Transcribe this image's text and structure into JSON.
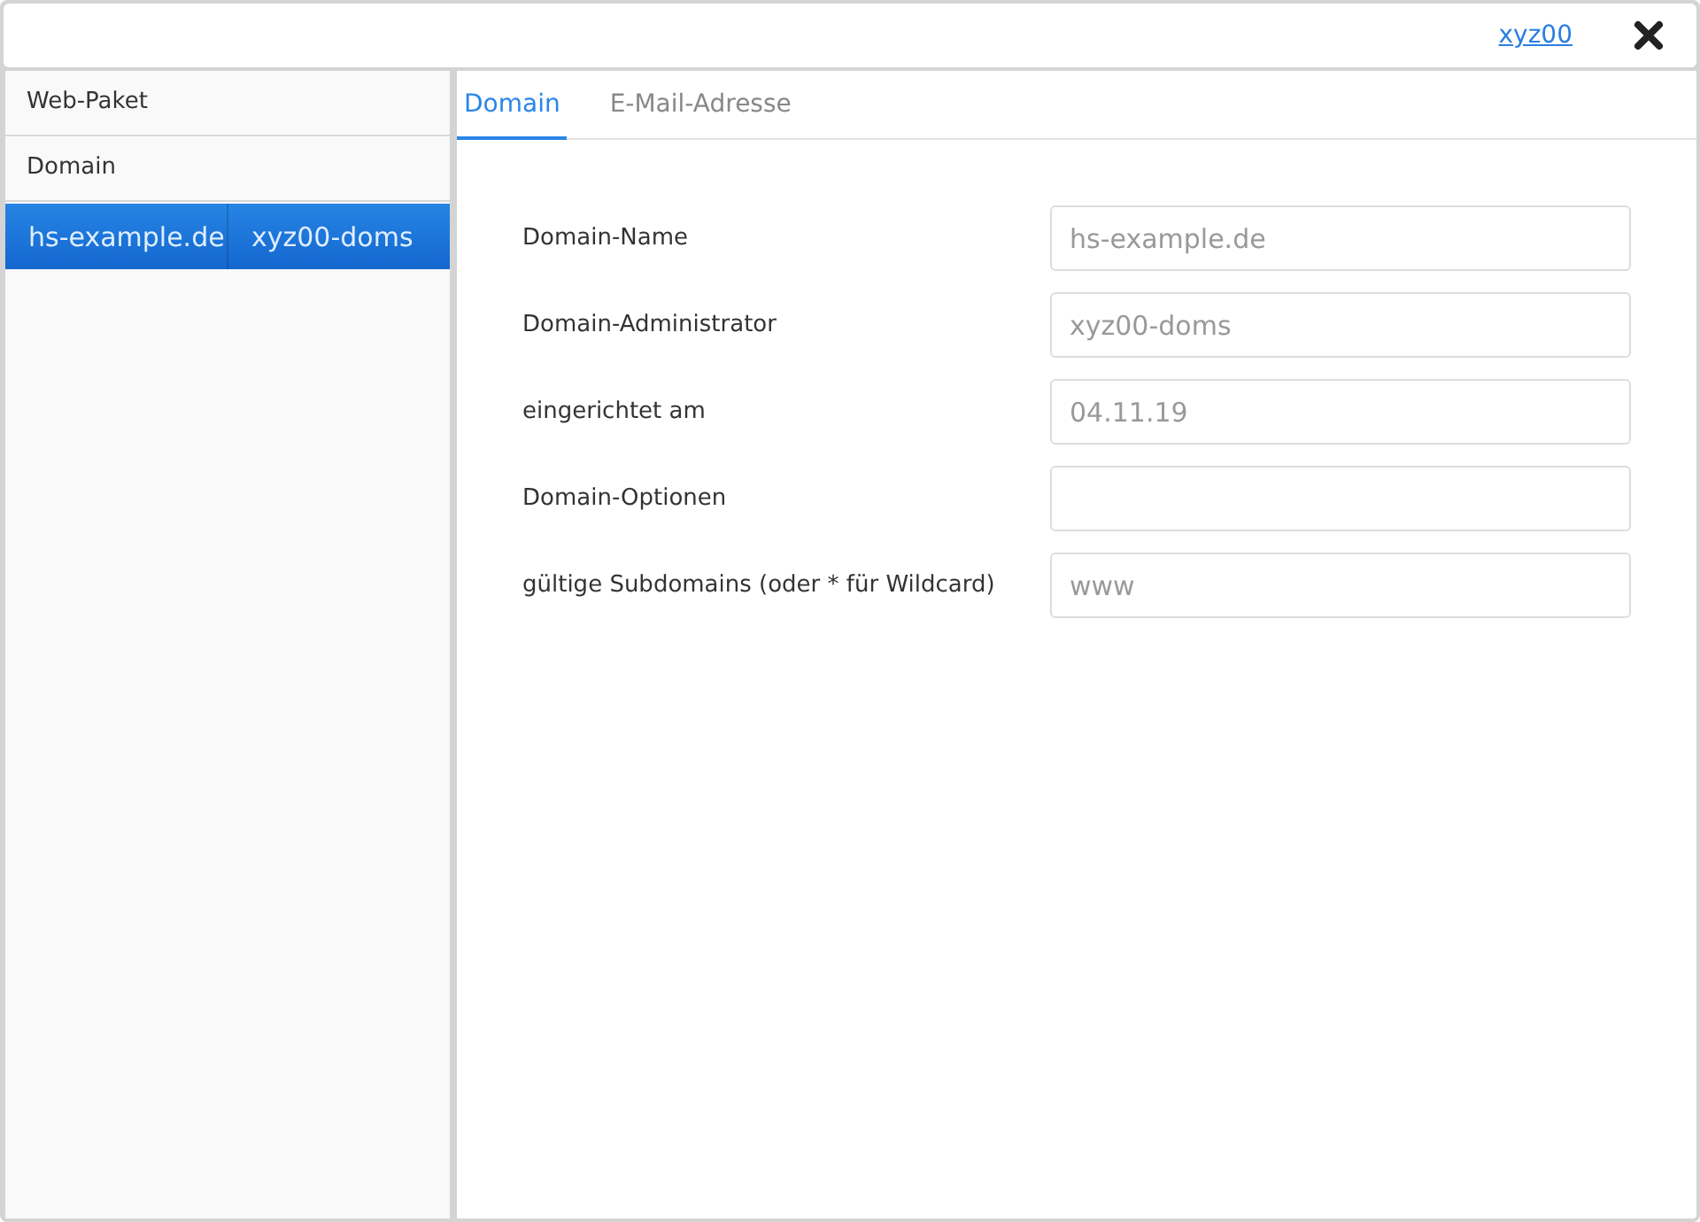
{
  "header": {
    "user_link": "xyz00"
  },
  "sidebar": {
    "sections": [
      {
        "label": "Web-Paket"
      },
      {
        "label": "Domain"
      }
    ],
    "rows": [
      {
        "cells": [
          "hs-example.de",
          "xyz00-doms"
        ],
        "selected": true
      }
    ]
  },
  "tabs": [
    {
      "label": "Domain",
      "selected": true
    },
    {
      "label": "E-Mail-Adresse",
      "selected": false
    }
  ],
  "form": {
    "fields": [
      {
        "label": "Domain-Name",
        "value": "hs-example.de"
      },
      {
        "label": "Domain-Administrator",
        "value": "xyz00-doms"
      },
      {
        "label": "eingerichtet am",
        "value": "04.11.19"
      },
      {
        "label": "Domain-Optionen"
      },
      {
        "label": "gültige Subdomains (oder * für Wildcard)",
        "value": "www"
      }
    ]
  }
}
